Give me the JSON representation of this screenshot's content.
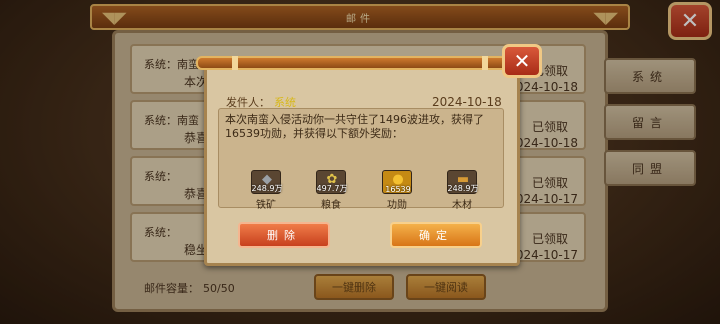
{
  "title": "邮件",
  "close_symbol": "✕",
  "mails": [
    {
      "sender": "系统：南蛮入侵",
      "subject": "本次",
      "status": "已领取",
      "date": "2024-10-18"
    },
    {
      "sender": "系统：南蛮",
      "subject": "恭喜",
      "status": "已领取",
      "date": "2024-10-18"
    },
    {
      "sender": "系统：",
      "subject": "恭喜",
      "status": "已领取",
      "date": "2024-10-17"
    },
    {
      "sender": "系统：",
      "subject": "稳坐",
      "status": "已领取",
      "date": "2024-10-17"
    }
  ],
  "capacity_label": "邮件容量：",
  "capacity_value": "50/50",
  "delete_all_label": "一键删除",
  "read_all_label": "一键阅读",
  "tabs": [
    "系统",
    "留言",
    "同盟"
  ],
  "dialog": {
    "from_label": "发件人：",
    "from_name": "系统",
    "date": "2024-10-18",
    "body": "本次南蛮入侵活动你一共守住了1496波进攻，获得了16539功勋，并获得以下额外奖励：",
    "rewards": [
      {
        "name": "铁矿",
        "qty": "248.9万",
        "icon": "ore-icon",
        "glyph": "◆",
        "color": "#9aa0a6"
      },
      {
        "name": "粮食",
        "qty": "497.7万",
        "icon": "grain-icon",
        "glyph": "✿",
        "color": "#e0c24a"
      },
      {
        "name": "功勋",
        "qty": "16539",
        "icon": "merit-medal-icon",
        "glyph": "●",
        "color": "#f4c030"
      },
      {
        "name": "木材",
        "qty": "248.9万",
        "icon": "wood-icon",
        "glyph": "▬",
        "color": "#d79a35"
      }
    ],
    "delete_label": "删除",
    "confirm_label": "确定"
  }
}
